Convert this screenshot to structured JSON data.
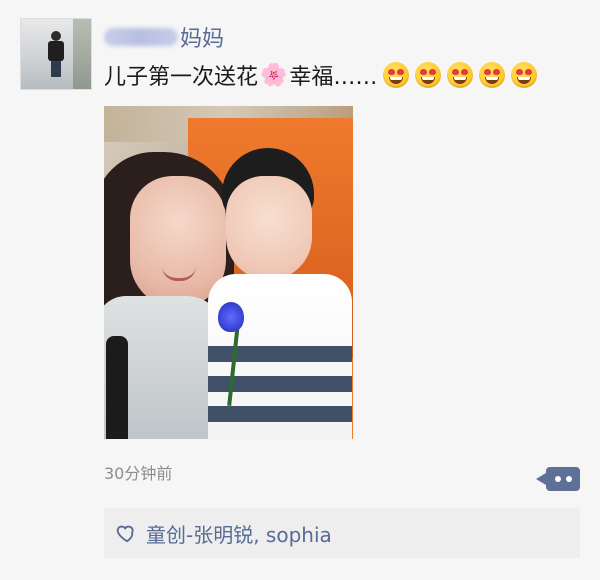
{
  "post": {
    "author_visible_suffix": "妈妈",
    "text_before_flower": "儿子第一次送花",
    "flower_emoji": "🌸",
    "text_after_flower": "幸福……",
    "emoji_reactions": [
      "smiling-face-with-heart-eyes",
      "smiling-face-with-heart-eyes",
      "smiling-face-with-heart-eyes",
      "smiling-face-with-heart-eyes",
      "smiling-face-with-heart-eyes"
    ],
    "time_ago": "30分钟前"
  },
  "likes": {
    "names": "童创-张明锐, sophia"
  },
  "colors": {
    "link_blue": "#576b95",
    "more_button_bg": "#5e6f98",
    "likes_bg": "#eeeeee",
    "time_gray": "#8c8c8c"
  },
  "icons": {
    "avatar": "avatar-photo",
    "more": "more-options-icon",
    "likes": "heart-outline-icon"
  }
}
